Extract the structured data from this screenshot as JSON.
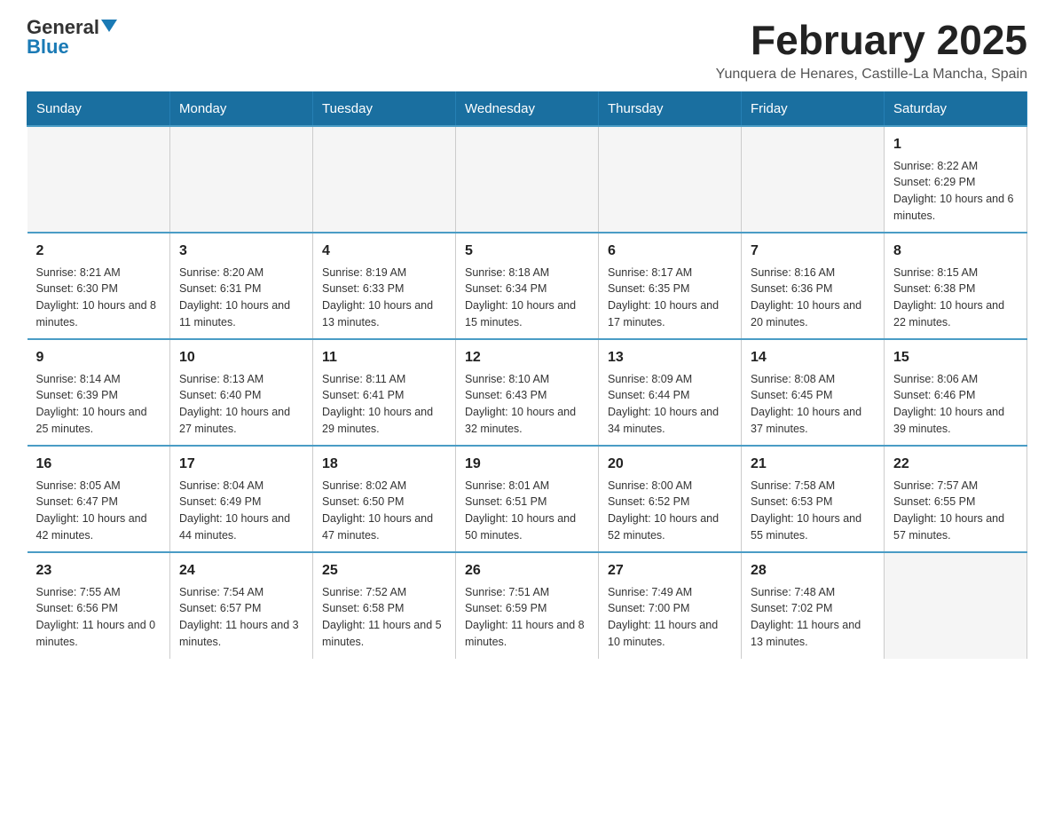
{
  "header": {
    "logo_general": "General",
    "logo_blue": "Blue",
    "month_title": "February 2025",
    "location": "Yunquera de Henares, Castille-La Mancha, Spain"
  },
  "days_of_week": [
    "Sunday",
    "Monday",
    "Tuesday",
    "Wednesday",
    "Thursday",
    "Friday",
    "Saturday"
  ],
  "weeks": [
    {
      "days": [
        {
          "num": "",
          "empty": true
        },
        {
          "num": "",
          "empty": true
        },
        {
          "num": "",
          "empty": true
        },
        {
          "num": "",
          "empty": true
        },
        {
          "num": "",
          "empty": true
        },
        {
          "num": "",
          "empty": true
        },
        {
          "num": "1",
          "sunrise": "Sunrise: 8:22 AM",
          "sunset": "Sunset: 6:29 PM",
          "daylight": "Daylight: 10 hours and 6 minutes."
        }
      ]
    },
    {
      "days": [
        {
          "num": "2",
          "sunrise": "Sunrise: 8:21 AM",
          "sunset": "Sunset: 6:30 PM",
          "daylight": "Daylight: 10 hours and 8 minutes."
        },
        {
          "num": "3",
          "sunrise": "Sunrise: 8:20 AM",
          "sunset": "Sunset: 6:31 PM",
          "daylight": "Daylight: 10 hours and 11 minutes."
        },
        {
          "num": "4",
          "sunrise": "Sunrise: 8:19 AM",
          "sunset": "Sunset: 6:33 PM",
          "daylight": "Daylight: 10 hours and 13 minutes."
        },
        {
          "num": "5",
          "sunrise": "Sunrise: 8:18 AM",
          "sunset": "Sunset: 6:34 PM",
          "daylight": "Daylight: 10 hours and 15 minutes."
        },
        {
          "num": "6",
          "sunrise": "Sunrise: 8:17 AM",
          "sunset": "Sunset: 6:35 PM",
          "daylight": "Daylight: 10 hours and 17 minutes."
        },
        {
          "num": "7",
          "sunrise": "Sunrise: 8:16 AM",
          "sunset": "Sunset: 6:36 PM",
          "daylight": "Daylight: 10 hours and 20 minutes."
        },
        {
          "num": "8",
          "sunrise": "Sunrise: 8:15 AM",
          "sunset": "Sunset: 6:38 PM",
          "daylight": "Daylight: 10 hours and 22 minutes."
        }
      ]
    },
    {
      "days": [
        {
          "num": "9",
          "sunrise": "Sunrise: 8:14 AM",
          "sunset": "Sunset: 6:39 PM",
          "daylight": "Daylight: 10 hours and 25 minutes."
        },
        {
          "num": "10",
          "sunrise": "Sunrise: 8:13 AM",
          "sunset": "Sunset: 6:40 PM",
          "daylight": "Daylight: 10 hours and 27 minutes."
        },
        {
          "num": "11",
          "sunrise": "Sunrise: 8:11 AM",
          "sunset": "Sunset: 6:41 PM",
          "daylight": "Daylight: 10 hours and 29 minutes."
        },
        {
          "num": "12",
          "sunrise": "Sunrise: 8:10 AM",
          "sunset": "Sunset: 6:43 PM",
          "daylight": "Daylight: 10 hours and 32 minutes."
        },
        {
          "num": "13",
          "sunrise": "Sunrise: 8:09 AM",
          "sunset": "Sunset: 6:44 PM",
          "daylight": "Daylight: 10 hours and 34 minutes."
        },
        {
          "num": "14",
          "sunrise": "Sunrise: 8:08 AM",
          "sunset": "Sunset: 6:45 PM",
          "daylight": "Daylight: 10 hours and 37 minutes."
        },
        {
          "num": "15",
          "sunrise": "Sunrise: 8:06 AM",
          "sunset": "Sunset: 6:46 PM",
          "daylight": "Daylight: 10 hours and 39 minutes."
        }
      ]
    },
    {
      "days": [
        {
          "num": "16",
          "sunrise": "Sunrise: 8:05 AM",
          "sunset": "Sunset: 6:47 PM",
          "daylight": "Daylight: 10 hours and 42 minutes."
        },
        {
          "num": "17",
          "sunrise": "Sunrise: 8:04 AM",
          "sunset": "Sunset: 6:49 PM",
          "daylight": "Daylight: 10 hours and 44 minutes."
        },
        {
          "num": "18",
          "sunrise": "Sunrise: 8:02 AM",
          "sunset": "Sunset: 6:50 PM",
          "daylight": "Daylight: 10 hours and 47 minutes."
        },
        {
          "num": "19",
          "sunrise": "Sunrise: 8:01 AM",
          "sunset": "Sunset: 6:51 PM",
          "daylight": "Daylight: 10 hours and 50 minutes."
        },
        {
          "num": "20",
          "sunrise": "Sunrise: 8:00 AM",
          "sunset": "Sunset: 6:52 PM",
          "daylight": "Daylight: 10 hours and 52 minutes."
        },
        {
          "num": "21",
          "sunrise": "Sunrise: 7:58 AM",
          "sunset": "Sunset: 6:53 PM",
          "daylight": "Daylight: 10 hours and 55 minutes."
        },
        {
          "num": "22",
          "sunrise": "Sunrise: 7:57 AM",
          "sunset": "Sunset: 6:55 PM",
          "daylight": "Daylight: 10 hours and 57 minutes."
        }
      ]
    },
    {
      "days": [
        {
          "num": "23",
          "sunrise": "Sunrise: 7:55 AM",
          "sunset": "Sunset: 6:56 PM",
          "daylight": "Daylight: 11 hours and 0 minutes."
        },
        {
          "num": "24",
          "sunrise": "Sunrise: 7:54 AM",
          "sunset": "Sunset: 6:57 PM",
          "daylight": "Daylight: 11 hours and 3 minutes."
        },
        {
          "num": "25",
          "sunrise": "Sunrise: 7:52 AM",
          "sunset": "Sunset: 6:58 PM",
          "daylight": "Daylight: 11 hours and 5 minutes."
        },
        {
          "num": "26",
          "sunrise": "Sunrise: 7:51 AM",
          "sunset": "Sunset: 6:59 PM",
          "daylight": "Daylight: 11 hours and 8 minutes."
        },
        {
          "num": "27",
          "sunrise": "Sunrise: 7:49 AM",
          "sunset": "Sunset: 7:00 PM",
          "daylight": "Daylight: 11 hours and 10 minutes."
        },
        {
          "num": "28",
          "sunrise": "Sunrise: 7:48 AM",
          "sunset": "Sunset: 7:02 PM",
          "daylight": "Daylight: 11 hours and 13 minutes."
        },
        {
          "num": "",
          "empty": true
        }
      ]
    }
  ]
}
